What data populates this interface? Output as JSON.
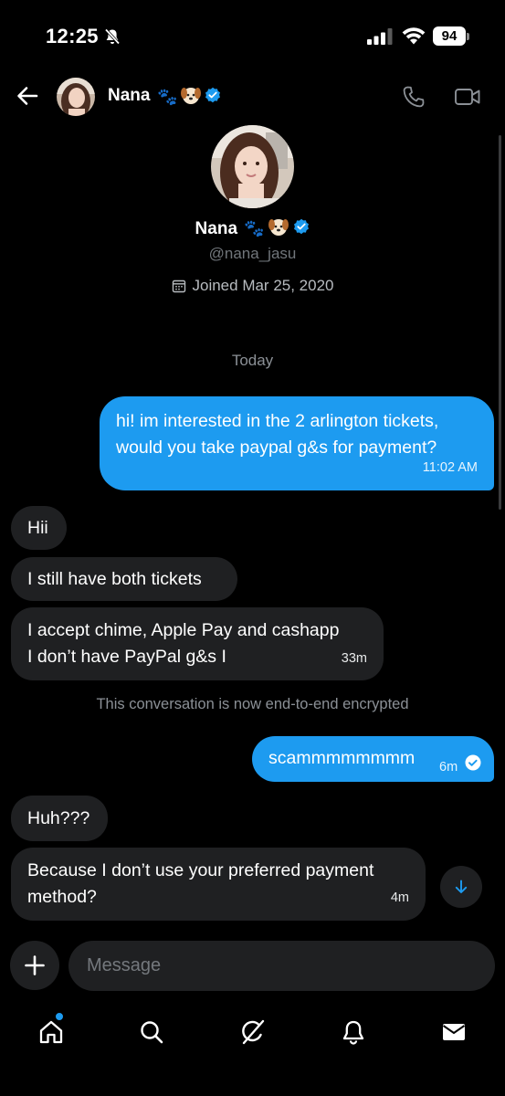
{
  "status_bar": {
    "time": "12:25",
    "battery": "94"
  },
  "header": {
    "name": "Nana",
    "emojis": "🐾🐶",
    "verified_color": "#1d9bf0"
  },
  "profile": {
    "name": "Nana",
    "handle": "@nana_jasu",
    "joined": "Joined Mar 25, 2020"
  },
  "conversation": {
    "date_separator": "Today",
    "encrypted_notice": "This conversation is now end-to-end encrypted",
    "messages": [
      {
        "direction": "out",
        "lines": [
          "hi! im interested in the 2 arlington tickets,",
          "would you take paypal g&s for payment?"
        ],
        "time": "11:02 AM"
      },
      {
        "direction": "in",
        "lines": [
          "Hii"
        ]
      },
      {
        "direction": "in",
        "lines": [
          "I still have both tickets"
        ]
      },
      {
        "direction": "in",
        "lines": [
          "I accept chime, Apple Pay and cashapp",
          "I don’t have PayPal g&s I"
        ],
        "time": "33m"
      },
      {
        "direction": "out",
        "lines": [
          "scammmmmmmm"
        ],
        "time": "6m"
      },
      {
        "direction": "in",
        "lines": [
          "Huh???"
        ]
      },
      {
        "direction": "in",
        "lines": [
          "Because I don’t use your preferred payment",
          "method?"
        ],
        "time": "4m"
      }
    ]
  },
  "composer": {
    "placeholder": "Message"
  },
  "nav": {
    "items": [
      "home-icon",
      "search-icon",
      "grok-icon",
      "bell-icon",
      "mail-icon"
    ]
  },
  "colors": {
    "accent": "#1d9bf0",
    "bubble_in": "#1f2022",
    "background": "#000000"
  }
}
